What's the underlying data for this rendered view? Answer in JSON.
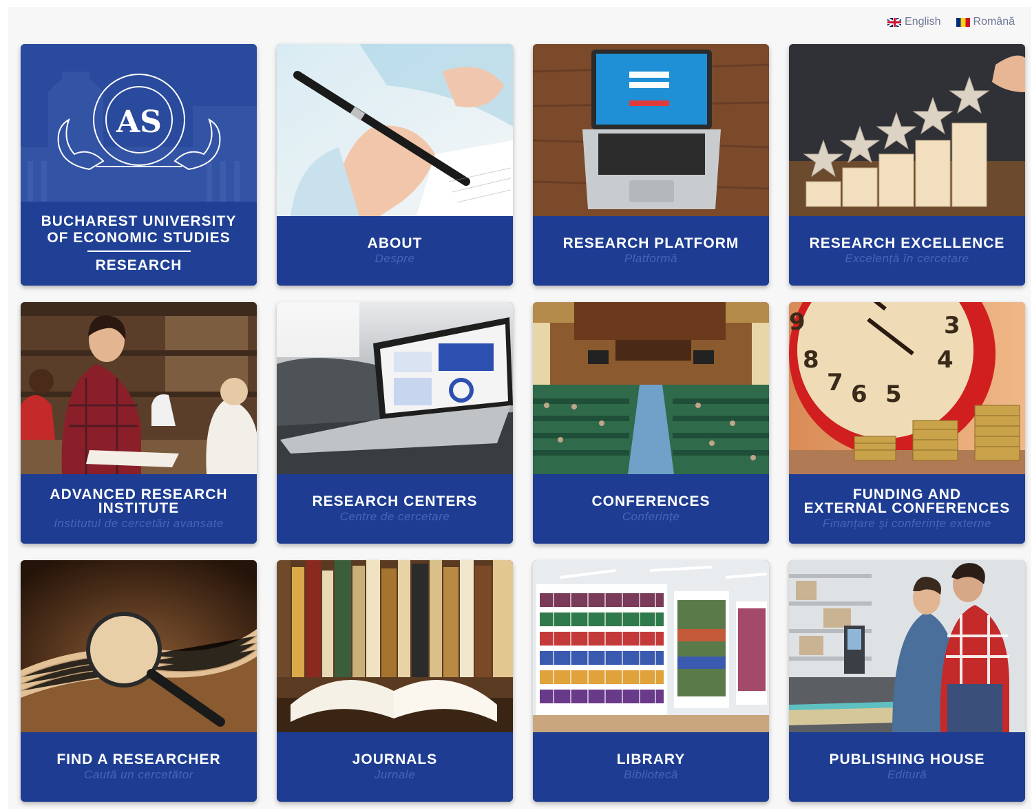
{
  "language_switcher": {
    "english": "English",
    "romanian": "Română"
  },
  "brand": {
    "name_line1": "BUCHAREST UNIVERSITY",
    "name_line2": "OF ECONOMIC STUDIES",
    "section": "RESEARCH"
  },
  "tiles": [
    {
      "title": "ABOUT",
      "subtitle": "Despre",
      "image": "hand-writing-with-pen"
    },
    {
      "title": "RESEARCH PLATFORM",
      "subtitle": "Platformă",
      "image": "laptop-login-screen"
    },
    {
      "title": "RESEARCH EXCELLENCE",
      "subtitle": "Excelență în cercetare",
      "image": "stars-on-blocks"
    },
    {
      "title_line1": "ADVANCED RESEARCH",
      "title_line2": "INSTITUTE",
      "subtitle": "Institutul de cercetări avansate",
      "image": "students-in-library"
    },
    {
      "title": "RESEARCH CENTERS",
      "subtitle": "Centre de cercetare",
      "image": "laptop-dashboard"
    },
    {
      "title": "CONFERENCES",
      "subtitle": "Conferințe",
      "image": "conference-hall"
    },
    {
      "title_line1": "FUNDING AND",
      "title_line2": "EXTERNAL CONFERENCES",
      "subtitle": "Finanțare și conferințe externe",
      "image": "clock-and-coins"
    },
    {
      "title": "FIND A RESEARCHER",
      "subtitle": "Caută un cercetător",
      "image": "magnifier-on-book"
    },
    {
      "title": "JOURNALS",
      "subtitle": "Jurnale",
      "image": "books-on-shelf"
    },
    {
      "title": "LIBRARY",
      "subtitle": "Bibliotecă",
      "image": "library-shelves"
    },
    {
      "title": "PUBLISHING HOUSE",
      "subtitle": "Editură",
      "image": "print-shop-workers"
    }
  ],
  "colors": {
    "tile_blue": "#1e3d92",
    "subtitle_blue": "#4566b8",
    "page_background": "#f7f7f7"
  }
}
